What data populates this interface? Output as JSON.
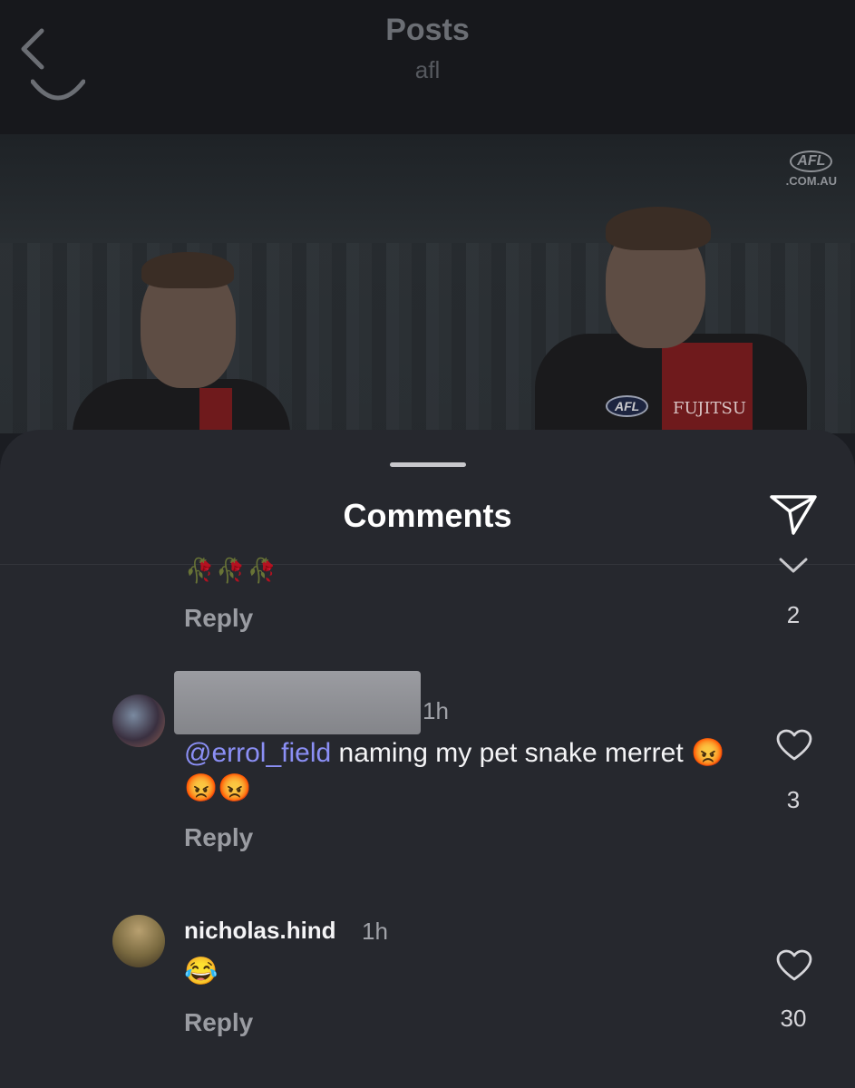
{
  "header": {
    "title": "Posts",
    "subtitle": "afl"
  },
  "post_image": {
    "watermark_logo": "AFL",
    "watermark_domain": ".COM.AU",
    "jersey_logo": "AFL",
    "jersey_sponsor": "FUJITSU"
  },
  "sheet": {
    "title": "Comments"
  },
  "comments": [
    {
      "text": "🥀🥀🥀",
      "reply_label": "Reply",
      "like_count": "2"
    },
    {
      "time": "1h",
      "mention": "@errol_field",
      "text_rest": " naming my pet snake merret 😡😡😡",
      "reply_label": "Reply",
      "like_count": "3"
    },
    {
      "username": "nicholas.hind",
      "time": "1h",
      "text": "😂",
      "reply_label": "Reply",
      "like_count": "30"
    }
  ],
  "colors": {
    "sheet_bg": "#26282e",
    "mention": "#8b8ff5",
    "muted": "#9a9ca2"
  }
}
